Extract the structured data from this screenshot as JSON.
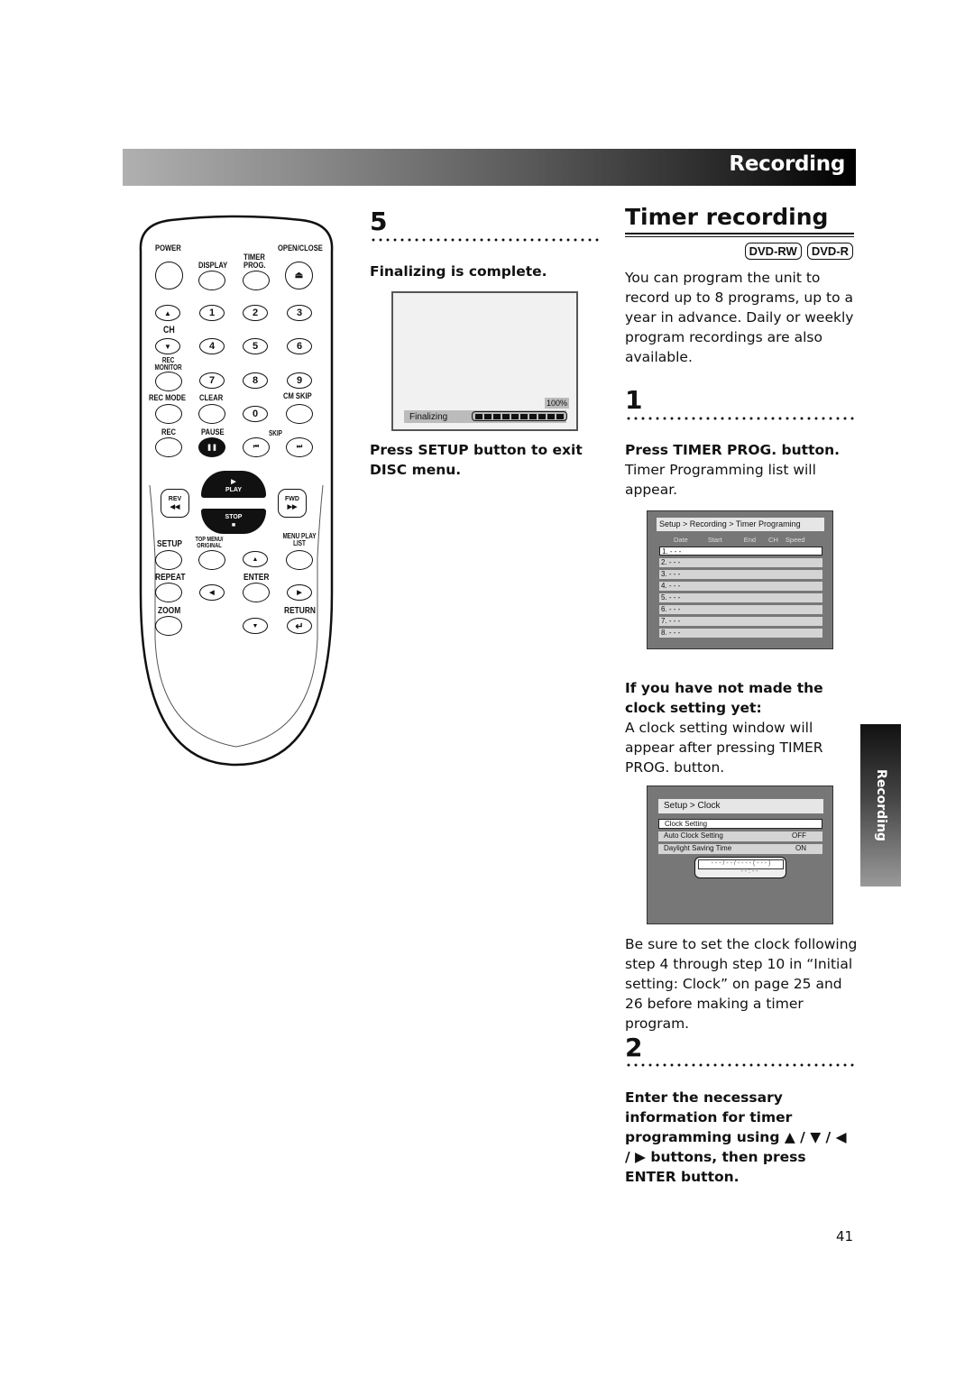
{
  "header": {
    "section_title": "Recording"
  },
  "side_tab": {
    "label": "Recording"
  },
  "page_number": "41",
  "remote": {
    "labels": {
      "power": "POWER",
      "display": "DISPLAY",
      "timer_prog": "TIMER PROG.",
      "open_close": "OPEN/CLOSE",
      "ch": "CH",
      "rec_monitor": "REC MONITOR",
      "rec_mode": "REC MODE",
      "clear": "CLEAR",
      "cm_skip": "CM SKIP",
      "rec": "REC",
      "pause": "PAUSE",
      "skip": "SKIP",
      "rev": "REV",
      "fwd": "FWD",
      "play": "PLAY",
      "stop": "STOP",
      "setup": "SETUP",
      "top_menu": "TOP MENU/ ORIGINAL",
      "menu_play_list": "MENU PLAY LIST",
      "repeat": "REPEAT",
      "enter": "ENTER",
      "zoom": "ZOOM",
      "return": "RETURN"
    },
    "digits": [
      "1",
      "2",
      "3",
      "4",
      "5",
      "6",
      "7",
      "8",
      "9",
      "0"
    ]
  },
  "step5": {
    "number": "5",
    "heading": "Finalizing is complete.",
    "screen": {
      "percent_label": "100%",
      "status_label": "Finalizing",
      "progress": 1.0,
      "segments": 10
    },
    "instruction": "Press SETUP button to exit DISC menu."
  },
  "section": {
    "title": "Timer recording",
    "badges": [
      "DVD-RW",
      "DVD-R"
    ],
    "intro": "You can program the unit to record up to 8 programs, up to a year in advance. Daily or weekly program recordings are also available."
  },
  "step1": {
    "number": "1",
    "heading": "Press TIMER PROG. button.",
    "body": "Timer Programming list will appear.",
    "timer_screen": {
      "breadcrumb": "Setup > Recording > Timer Programing",
      "columns": [
        "Date",
        "Start",
        "End",
        "CH",
        "Speed"
      ],
      "rows": [
        "1. - - -",
        "2. - - -",
        "3. - - -",
        "4. - - -",
        "5. - - -",
        "6. - - -",
        "7. - - -",
        "8. - - -"
      ]
    },
    "note_heading": "If you have not made the clock setting yet:",
    "note_body": "A clock setting window will appear after pressing TIMER PROG. button.",
    "clock_screen": {
      "breadcrumb": "Setup > Clock",
      "items": [
        {
          "label": "Clock Setting",
          "value": ""
        },
        {
          "label": "Auto Clock Setting",
          "value": "OFF"
        },
        {
          "label": "Daylight Saving Time",
          "value": "ON"
        }
      ],
      "date_placeholder": "- - - / - - / - - - - ( - - - )",
      "time_placeholder": "- - : - -"
    },
    "reminder": "Be sure to set the clock following step 4 through step 10 in “Initial setting: Clock” on page 25 and 26 before making a timer program."
  },
  "step2": {
    "number": "2",
    "instruction": "Enter the necessary information for timer programming using ▲ / ▼ / ◀ / ▶ buttons, then press ENTER button."
  }
}
